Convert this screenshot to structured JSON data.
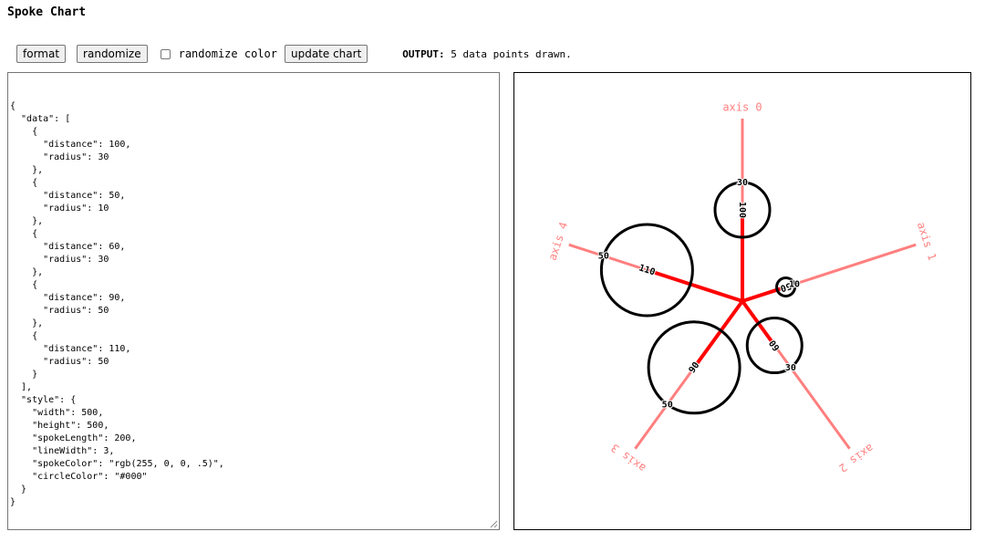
{
  "page": {
    "title": "Spoke Chart"
  },
  "toolbar": {
    "format_label": "format",
    "randomize_label": "randomize",
    "randomize_color_label": "randomize color",
    "randomize_color_checked": false,
    "update_label": "update chart",
    "output_prefix": "OUTPUT:",
    "output_text": "5 data points drawn."
  },
  "editor": {
    "text": "{\n  \"data\": [\n    {\n      \"distance\": 100,\n      \"radius\": 30\n    },\n    {\n      \"distance\": 50,\n      \"radius\": 10\n    },\n    {\n      \"distance\": 60,\n      \"radius\": 30\n    },\n    {\n      \"distance\": 90,\n      \"radius\": 50\n    },\n    {\n      \"distance\": 110,\n      \"radius\": 50\n    }\n  ],\n  \"style\": {\n    \"width\": 500,\n    \"height\": 500,\n    \"spokeLength\": 200,\n    \"lineWidth\": 3,\n    \"spokeColor\": \"rgb(255, 0, 0, .5)\",\n    \"circleColor\": \"#000\"\n  }\n}"
  },
  "chart_data": {
    "type": "spoke",
    "axes": [
      "axis 0",
      "axis 1",
      "axis 2",
      "axis 3",
      "axis 4"
    ],
    "points": [
      {
        "axis": "axis 0",
        "distance": 100,
        "radius": 30
      },
      {
        "axis": "axis 1",
        "distance": 50,
        "radius": 10
      },
      {
        "axis": "axis 2",
        "distance": 60,
        "radius": 30
      },
      {
        "axis": "axis 3",
        "distance": 90,
        "radius": 50
      },
      {
        "axis": "axis 4",
        "distance": 110,
        "radius": 50
      }
    ],
    "spoke_length": 200,
    "spoke_color": "rgba(255, 0, 0, 0.5)",
    "value_color": "#ff0000",
    "circle_color": "#000000"
  }
}
